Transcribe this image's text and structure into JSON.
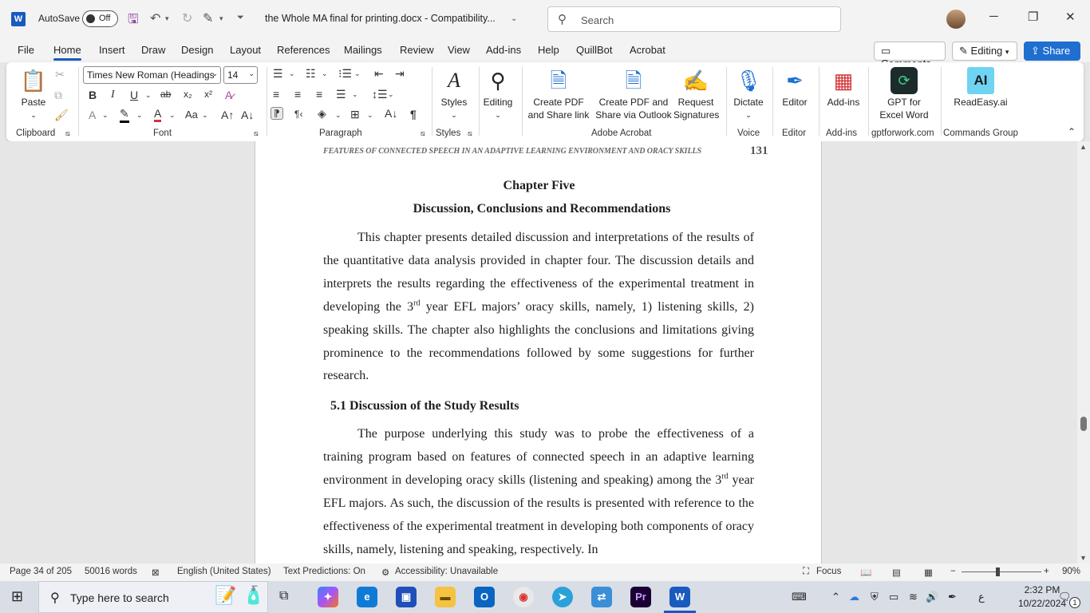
{
  "titlebar": {
    "autosave_label": "AutoSave",
    "toggle_state": "Off",
    "doc_title": "the Whole MA final for printing.docx  -  Compatibility...",
    "search_placeholder": "Search"
  },
  "tabs": [
    "File",
    "Home",
    "Insert",
    "Draw",
    "Design",
    "Layout",
    "References",
    "Mailings",
    "Review",
    "View",
    "Add-ins",
    "Help",
    "QuillBot",
    "Acrobat"
  ],
  "active_tab": "Home",
  "top_buttons": {
    "comments": "Comments",
    "editing": "Editing",
    "share": "Share"
  },
  "ribbon": {
    "paste": "Paste",
    "font_name": "Times New Roman (Headings",
    "font_size": "14",
    "styles": "Styles",
    "editing": "Editing",
    "create_pdf_link": "Create PDF and Share link",
    "create_pdf_outlook": "Create PDF and Share via Outlook",
    "request_signatures": "Request Signatures",
    "dictate": "Dictate",
    "editor": "Editor",
    "addins": "Add-ins",
    "gpt": "GPT for Excel Word",
    "readeasy": "ReadEasy.ai",
    "groups": {
      "clipboard": "Clipboard",
      "font": "Font",
      "paragraph": "Paragraph",
      "styles": "Styles",
      "adobe": "Adobe Acrobat",
      "voice": "Voice",
      "editor": "Editor",
      "addins": "Add-ins",
      "gptforwork": "gptforwork.com",
      "commands": "Commands Group"
    }
  },
  "document": {
    "running_header": "FEATURES OF CONNECTED SPEECH IN AN ADAPTIVE LEARNING ENVIRONMENT AND ORACY SKILLS",
    "page_number": "131",
    "chapter_title": "Chapter Five",
    "chapter_subtitle": "Discussion, Conclusions and Recommendations",
    "para1_a": "This chapter presents detailed discussion and interpretations of the results of the quantitative data analysis provided in chapter four. The discussion details and interprets the results regarding the effectiveness of the experimental treatment in developing the 3",
    "para1_sup": "rd",
    "para1_b": " year EFL majors’ oracy skills, namely, 1) listening skills, 2) speaking skills. The chapter also highlights the conclusions and limitations giving prominence to the recommendations followed by some suggestions for further research.",
    "section_heading": "5.1 Discussion of the Study Results",
    "para2_a": "The purpose underlying this study was to probe the effectiveness of a training program based on features of connected speech in an adaptive learning environment in developing oracy skills (listening and speaking) among the 3",
    "para2_sup": "rd",
    "para2_b": " year EFL majors. As such, the discussion of the results is presented with reference to the effectiveness of the experimental treatment in developing both components of oracy skills, namely, listening and speaking, respectively. In"
  },
  "status": {
    "page": "Page 34 of 205",
    "words": "50016 words",
    "language": "English (United States)",
    "predictions": "Text Predictions: On",
    "accessibility": "Accessibility: Unavailable",
    "focus": "Focus",
    "zoom": "90%"
  },
  "taskbar": {
    "search_placeholder": "Type here to search",
    "time": "2:32 PM",
    "date": "10/22/2024",
    "lang": "ع",
    "notif": "1"
  },
  "colors": {
    "word_blue": "#185abd",
    "share_blue": "#1e6fd0"
  }
}
